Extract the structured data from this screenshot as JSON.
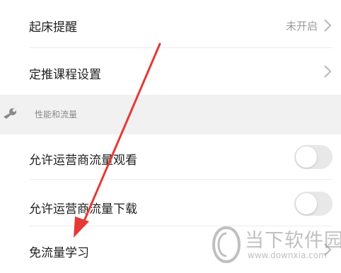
{
  "settings": {
    "wake_reminder": {
      "label": "起床提醒",
      "status": "未开启"
    },
    "push_course": {
      "label": "定推课程设置"
    },
    "section_performance": {
      "label": "性能和流量"
    },
    "allow_cellular_watch": {
      "label": "允许运营商流量观看",
      "enabled": false
    },
    "allow_cellular_download": {
      "label": "允许运营商流量下载",
      "enabled": false
    },
    "free_data_learning": {
      "label": "免流量学习"
    }
  },
  "watermark": {
    "brand": "当下软件园",
    "url": "www.downxia.com"
  },
  "icons": {
    "section_icon": "wrench-icon",
    "chevron": "chevron-right-icon"
  },
  "colors": {
    "annotation_arrow": "#e53935",
    "section_background": "#f1f1f1",
    "toggle_off": "#e8e8e8"
  }
}
